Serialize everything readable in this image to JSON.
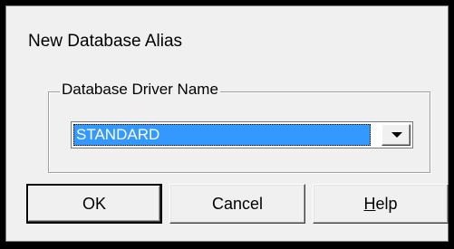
{
  "dialog": {
    "title": "New Database Alias",
    "group_label": "Database Driver Name",
    "driver_select": {
      "selected_value": "STANDARD"
    },
    "buttons": {
      "ok_label": "OK",
      "cancel_label": "Cancel",
      "help_mnemonic": "H",
      "help_rest": "elp"
    }
  },
  "colors": {
    "selection_highlight": "#3399ff",
    "dialog_face": "#f0f0f0"
  },
  "icons": {
    "dropdown": "chevron-down-icon"
  }
}
